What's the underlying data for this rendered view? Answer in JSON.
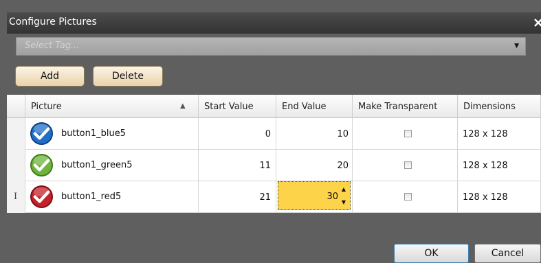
{
  "window": {
    "title": "Configure Pictures"
  },
  "tag_select": {
    "placeholder": "Select Tag..."
  },
  "toolbar": {
    "add_label": "Add",
    "delete_label": "Delete"
  },
  "grid": {
    "columns": [
      "Picture",
      "Start Value",
      "End Value",
      "Make Transparent",
      "Dimensions"
    ],
    "sort_indicator": "▲",
    "rows": [
      {
        "picture": "button1_blue5",
        "start": "0",
        "end": "10",
        "transparent": false,
        "dimensions": "128 x 128",
        "icon_color": "#1f6fc7"
      },
      {
        "picture": "button1_green5",
        "start": "11",
        "end": "20",
        "transparent": false,
        "dimensions": "128 x 128",
        "icon_color": "#6fb33a"
      },
      {
        "picture": "button1_red5",
        "start": "21",
        "end": "30",
        "transparent": false,
        "dimensions": "128 x 128",
        "icon_color": "#c3202a"
      }
    ],
    "editing_cell_color": "#fdd34a"
  },
  "footer": {
    "ok_label": "OK",
    "cancel_label": "Cancel"
  }
}
